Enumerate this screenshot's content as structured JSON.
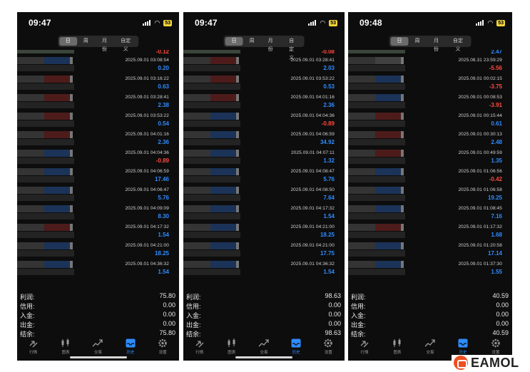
{
  "tabs": [
    "日",
    "周",
    "月份",
    "自定义"
  ],
  "nav": [
    {
      "label": "行情",
      "icon": "quotes-icon"
    },
    {
      "label": "图表",
      "icon": "candlestick-chart-icon"
    },
    {
      "label": "交易",
      "icon": "trade-icon"
    },
    {
      "label": "历史",
      "icon": "history-icon"
    },
    {
      "label": "设置",
      "icon": "settings-icon"
    }
  ],
  "summary_labels": [
    "利润:",
    "信用:",
    "入金:",
    "出金:",
    "结余:"
  ],
  "colors": {
    "positive": "#2e8cff",
    "negative": "#ff4a3d",
    "battery": "#f1d43a"
  },
  "phones": [
    {
      "time": "09:47",
      "battery": "53",
      "top_value": "-0.12",
      "trades": [
        {
          "date": "2025.09.01 03:08:54",
          "value": "0.20",
          "tint": "blue"
        },
        {
          "date": "2025.09.01 03:16:22",
          "value": "0.63",
          "tint": "red"
        },
        {
          "date": "2025.09.01 03:28:41",
          "value": "2.38",
          "tint": "red"
        },
        {
          "date": "2025.09.01 03:53:22",
          "value": "0.54",
          "tint": "red"
        },
        {
          "date": "2025.09.01 04:01:16",
          "value": "2.36",
          "tint": "red"
        },
        {
          "date": "2025.09.01 04:04:36",
          "value": "-0.89",
          "tint": "blue"
        },
        {
          "date": "2025.09.01 04:06:59",
          "value": "17.46",
          "tint": "blue"
        },
        {
          "date": "2025.09.01 04:06:47",
          "value": "5.76",
          "tint": "blue"
        },
        {
          "date": "2025.09.01 04:09:09",
          "value": "8.30",
          "tint": "blue"
        },
        {
          "date": "2025.09.01 04:17:32",
          "value": "1.54",
          "tint": "red"
        },
        {
          "date": "2025.09.01 04:21:00",
          "value": "18.25",
          "tint": "blue"
        },
        {
          "date": "2025.09.01 04:36:32",
          "value": "1.54",
          "tint": "blue"
        }
      ],
      "summary": [
        "75.80",
        "0.00",
        "0.00",
        "0.00",
        "75.80"
      ]
    },
    {
      "time": "09:47",
      "battery": "53",
      "top_value": "-0.08",
      "trades": [
        {
          "date": "2025.09.01 03:28:41",
          "value": "2.03",
          "tint": "red"
        },
        {
          "date": "2025.09.01 03:53:22",
          "value": "0.53",
          "tint": "red"
        },
        {
          "date": "2025.09.01 04:01:16",
          "value": "2.36",
          "tint": "red"
        },
        {
          "date": "2025.09.01 04:04:36",
          "value": "-0.89",
          "tint": "blue"
        },
        {
          "date": "2025.09.01 04:06:59",
          "value": "34.92",
          "tint": "blue"
        },
        {
          "date": "2025.09.01 04:07:11",
          "value": "1.32",
          "tint": "blue"
        },
        {
          "date": "2025.09.01 04:08:47",
          "value": "5.76",
          "tint": "blue"
        },
        {
          "date": "2025.09.01 04:08:50",
          "value": "7.64",
          "tint": "blue"
        },
        {
          "date": "2025.09.01 04:17:32",
          "value": "1.54",
          "tint": "blue"
        },
        {
          "date": "2025.09.01 04:21:00",
          "value": "18.25",
          "tint": "blue"
        },
        {
          "date": "2025.09.01 04:21:00",
          "value": "17.75",
          "tint": "blue"
        },
        {
          "date": "2025.09.01 04:36:32",
          "value": "1.54",
          "tint": "blue"
        }
      ],
      "summary": [
        "98.63",
        "0.00",
        "0.00",
        "0.00",
        "98.63"
      ]
    },
    {
      "time": "09:48",
      "battery": "53",
      "top_value": "2.47",
      "trades": [
        {
          "date": "2025.08.31 23:59:29",
          "value": "-5.56",
          "tint": "grey"
        },
        {
          "date": "2025.09.01 00:02:15",
          "value": "-3.75",
          "tint": "blue"
        },
        {
          "date": "2025.09.01 00:08:53",
          "value": "-3.91",
          "tint": "blue"
        },
        {
          "date": "2025.09.01 00:15:44",
          "value": "0.61",
          "tint": "red"
        },
        {
          "date": "2025.09.01 00:30:13",
          "value": "2.48",
          "tint": "red"
        },
        {
          "date": "2025.09.01 00:49:59",
          "value": "1.35",
          "tint": "red"
        },
        {
          "date": "2025.09.01 01:06:56",
          "value": "-0.42",
          "tint": "blue"
        },
        {
          "date": "2025.09.01 01:06:58",
          "value": "19.25",
          "tint": "blue"
        },
        {
          "date": "2025.09.01 01:08:45",
          "value": "7.16",
          "tint": "blue"
        },
        {
          "date": "2025.09.01 01:17:32",
          "value": "1.68",
          "tint": "red"
        },
        {
          "date": "2025.09.01 01:20:58",
          "value": "17.14",
          "tint": "blue"
        },
        {
          "date": "2025.09.01 01:37:30",
          "value": "1.55",
          "tint": "blue"
        }
      ],
      "summary": [
        "40.59",
        "0.00",
        "0.00",
        "0.00",
        "40.59"
      ]
    }
  ],
  "logo_text": "EAMOL"
}
